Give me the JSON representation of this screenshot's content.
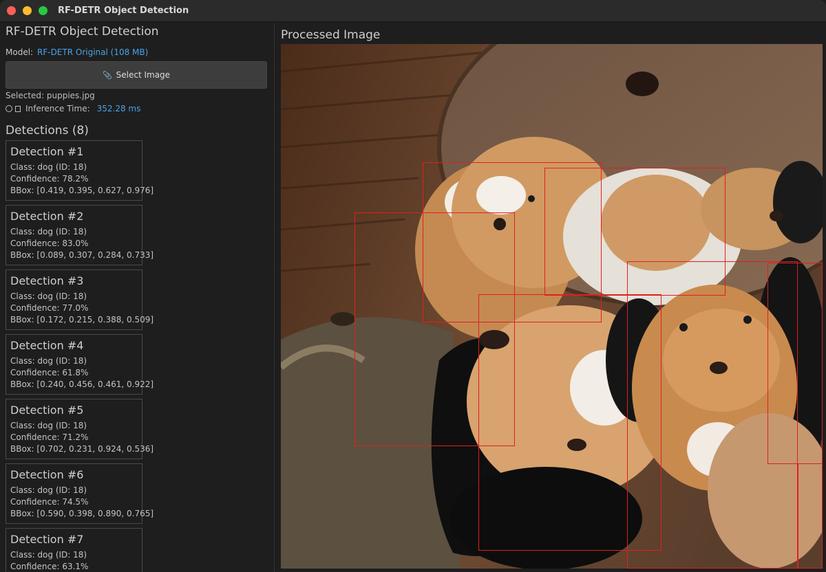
{
  "window": {
    "title": "RF-DETR Object Detection"
  },
  "sidebar": {
    "title": "RF-DETR Object Detection",
    "model_label": "Model:",
    "model_value": "RF-DETR Original (108 MB)",
    "select_button": "Select Image",
    "selected_text": "Selected: puppies.jpg",
    "inference_label": "Inference Time:",
    "inference_value": "352.28 ms",
    "detections_header": "Detections (8)"
  },
  "detections": [
    {
      "title": "Detection #1",
      "class_line": "Class: dog (ID: 18)",
      "confidence_line": "Confidence: 78.2%",
      "bbox_line": "BBox: [0.419, 0.395, 0.627, 0.976]"
    },
    {
      "title": "Detection #2",
      "class_line": "Class: dog (ID: 18)",
      "confidence_line": "Confidence: 83.0%",
      "bbox_line": "BBox: [0.089, 0.307, 0.284, 0.733]"
    },
    {
      "title": "Detection #3",
      "class_line": "Class: dog (ID: 18)",
      "confidence_line": "Confidence: 77.0%",
      "bbox_line": "BBox: [0.172, 0.215, 0.388, 0.509]"
    },
    {
      "title": "Detection #4",
      "class_line": "Class: dog (ID: 18)",
      "confidence_line": "Confidence: 61.8%",
      "bbox_line": "BBox: [0.240, 0.456, 0.461, 0.922]"
    },
    {
      "title": "Detection #5",
      "class_line": "Class: dog (ID: 18)",
      "confidence_line": "Confidence: 71.2%",
      "bbox_line": "BBox: [0.702, 0.231, 0.924, 0.536]"
    },
    {
      "title": "Detection #6",
      "class_line": "Class: dog (ID: 18)",
      "confidence_line": "Confidence: 74.5%",
      "bbox_line": "BBox: [0.590, 0.398, 0.890, 0.765]"
    },
    {
      "title": "Detection #7",
      "class_line": "Class: dog (ID: 18)",
      "confidence_line": "Confidence: 63.1%",
      "bbox_line": ""
    }
  ],
  "main": {
    "title": "Processed Image"
  },
  "colors": {
    "accent": "#4aa3e8",
    "bbox": "#e02020"
  },
  "icons": {
    "select_button": "paperclip-icon",
    "inference": "stopwatch-icon"
  }
}
